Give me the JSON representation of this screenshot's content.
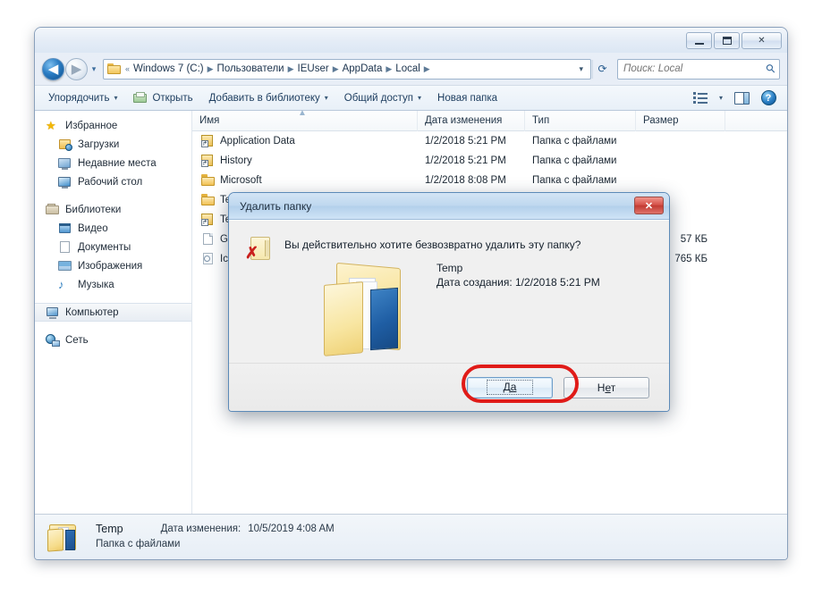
{
  "window": {
    "controls": {
      "minimize": "—",
      "maximize": "▫",
      "close": "✕"
    }
  },
  "address": {
    "back_icon": "back-arrow-icon",
    "forward_icon": "forward-arrow-icon",
    "history_caret": "▾",
    "crumbs": [
      "Windows 7 (C:)",
      "Пользователи",
      "IEUser",
      "AppData",
      "Local"
    ],
    "prefix": "«",
    "separator": "▶",
    "dropdown_caret": "▾",
    "refresh_icon": "↵",
    "search_placeholder": "Поиск: Local",
    "search_value": "",
    "search_icon": "search-icon"
  },
  "toolbar": {
    "organize": "Упорядочить",
    "open": "Открыть",
    "add_to_library": "Добавить в библиотеку",
    "share": "Общий доступ",
    "new_folder": "Новая папка",
    "caret": "▾",
    "views_icon": "views-list-icon",
    "preview_icon": "preview-pane-icon",
    "help_icon": "help-icon"
  },
  "sidebar": {
    "groups": [
      {
        "header": {
          "label": "Избранное",
          "icon": "star-icon"
        },
        "items": [
          {
            "label": "Загрузки",
            "icon": "downloads-icon"
          },
          {
            "label": "Недавние места",
            "icon": "recent-places-icon"
          },
          {
            "label": "Рабочий стол",
            "icon": "desktop-icon"
          }
        ]
      },
      {
        "header": {
          "label": "Библиотеки",
          "icon": "libraries-icon"
        },
        "items": [
          {
            "label": "Видео",
            "icon": "video-icon"
          },
          {
            "label": "Документы",
            "icon": "documents-icon"
          },
          {
            "label": "Изображения",
            "icon": "pictures-icon"
          },
          {
            "label": "Музыка",
            "icon": "music-icon"
          }
        ]
      }
    ],
    "computer": {
      "label": "Компьютер",
      "icon": "computer-icon",
      "selected": true
    },
    "network": {
      "label": "Сеть",
      "icon": "network-icon"
    }
  },
  "file_list": {
    "columns": [
      "Имя",
      "Дата изменения",
      "Тип",
      "Размер"
    ],
    "rows": [
      {
        "name": "Application Data",
        "date": "1/2/2018 5:21 PM",
        "type": "Папка с файлами",
        "size": "",
        "icon": "shortcut-icon"
      },
      {
        "name": "History",
        "date": "1/2/2018 5:21 PM",
        "type": "Папка с файлами",
        "size": "",
        "icon": "shortcut-icon"
      },
      {
        "name": "Microsoft",
        "date": "1/2/2018 8:08 PM",
        "type": "Папка с файлами",
        "size": "",
        "icon": "folder-icon"
      },
      {
        "name": "Te",
        "date": "",
        "type": "",
        "size": "",
        "icon": "folder-icon"
      },
      {
        "name": "Te",
        "date": "",
        "type": "",
        "size": "",
        "icon": "shortcut-icon"
      },
      {
        "name": "GD",
        "date": "",
        "type": "",
        "size": "57 КБ",
        "icon": "file-icon"
      },
      {
        "name": "Ico",
        "date": "",
        "type": "",
        "size": "765 КБ",
        "icon": "ico-file-icon"
      }
    ]
  },
  "details_bar": {
    "name": "Temp",
    "type": "Папка с файлами",
    "date_label": "Дата изменения:",
    "date_value": "10/5/2019 4:08 AM",
    "icon": "open-folder-icon"
  },
  "dialog": {
    "title": "Удалить папку",
    "close_label": "✕",
    "question": "Вы действительно хотите безвозвратно удалить эту папку?",
    "item_name": "Temp",
    "item_created": "Дата создания: 1/2/2018 5:21 PM",
    "warn_icon": "folder-delete-icon",
    "big_icon": "open-folder-large-icon",
    "buttons": {
      "yes_prefix": "Д",
      "yes_accel": "а",
      "no_prefix": "Н",
      "no_accel": "е",
      "no_suffix": "т"
    }
  },
  "annotation": {
    "ring_color": "#e01b18",
    "target": "yes-button"
  }
}
